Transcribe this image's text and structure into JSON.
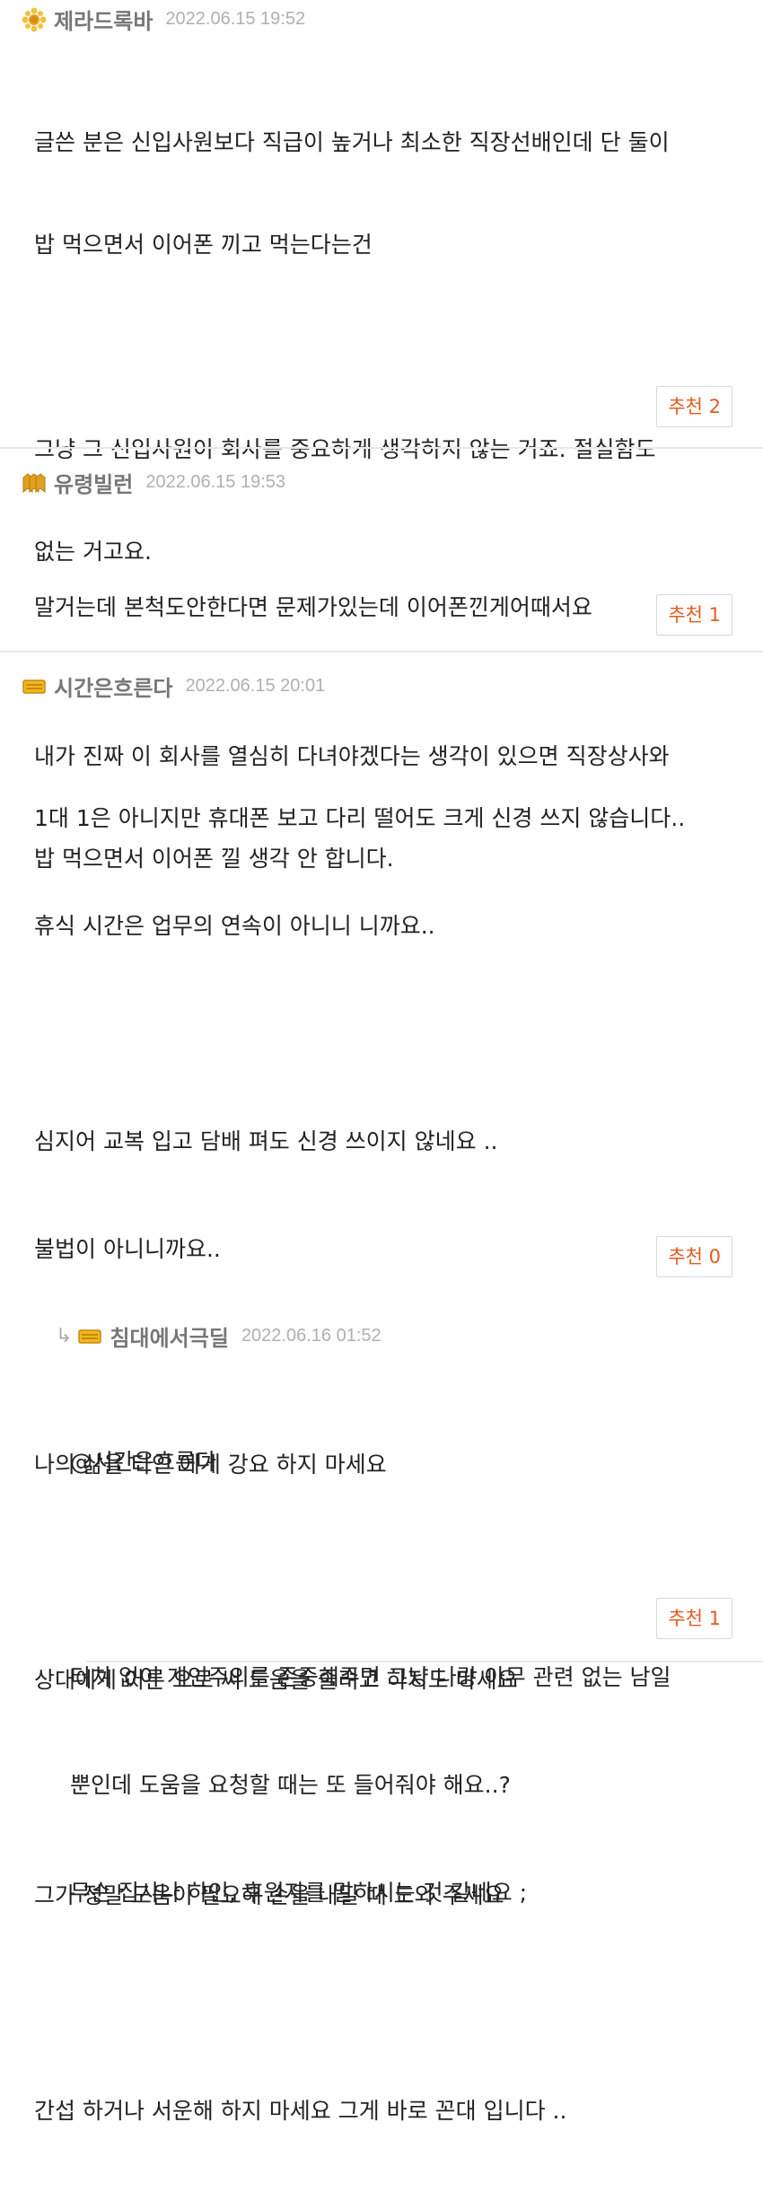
{
  "comments": [
    {
      "author": "제라드록바",
      "time": "2022.06.15 19:52",
      "icon": "gold-star-badge-icon",
      "lines": [
        "글쓴 분은 신입사원보다 직급이 높거나 최소한 직장선배인데 단 둘이",
        "밥 먹으면서 이어폰 끼고 먹는다는건",
        "",
        "그냥 그 신입사원이 회사를 중요하게 생각하지 않는 거죠. 절실함도",
        "없는 거고요.",
        "",
        "내가 진짜 이 회사를 열심히 다녀야겠다는 생각이 있으면 직장상사와",
        "밥 먹으면서 이어폰 낄 생각 안 합니다."
      ],
      "recommend": "추천 2"
    },
    {
      "author": "유령빌런",
      "time": "2022.06.15 19:53",
      "icon": "gold-chevron-badge-icon",
      "lines": [
        "말거는데 본척도안한다면 문제가있는데 이어폰낀게어때서요"
      ],
      "recommend": "추천 1"
    },
    {
      "author": "시간은흐른다",
      "time": "2022.06.15 20:01",
      "icon": "gold-bar-badge-icon",
      "lines": [
        "1대 1은 아니지만 휴대폰 보고 다리 떨어도 크게 신경 쓰지 않습니다..",
        "휴식 시간은 업무의 연속이 아니니 니까요..",
        "",
        "심지어 교복 입고 담배 펴도 신경 쓰이지 않네요 ..",
        "불법이 아니니까요..",
        "",
        "나의 삶을 타인 에게 강요 하지 마세요",
        "",
        "상대에게 어른 으로 써 도움을 줄려고 하지도 마세요",
        "",
        "그가 정말 도움이 필요해 손을 내밀 때 도와 주세요",
        "",
        "간섭 하거나 서운해 하지 마세요 그게 바로 꼰대 입니다 .."
      ],
      "recommend": "추천 0"
    }
  ],
  "reply": {
    "reply_arrow": "↳",
    "author": "침대에서극딜",
    "time": "2022.06.16 01:52",
    "icon": "gold-bar-badge-icon",
    "lines": [
      "@시간은흐른다",
      "",
      "터치 없이 개인주의를 존중해주면 그냥 나랑 아무 관련 없는 남일",
      "뿐인데 도움을 요청할 때는 또 들어줘야 해요..?",
      "무슨 집사나 하인, 후원자를 말하시는 것 같네요 ;"
    ],
    "recommend": "추천 1"
  }
}
